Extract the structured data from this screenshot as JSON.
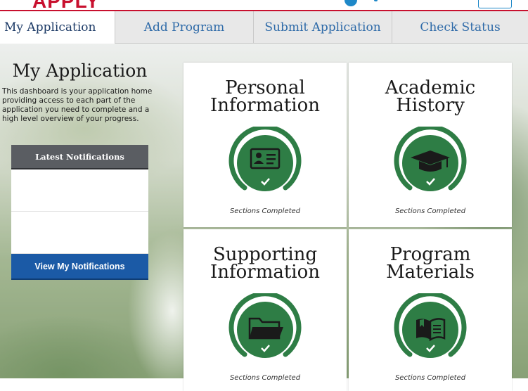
{
  "header": {
    "logo_text": "APPLY"
  },
  "tabs": [
    {
      "label": "My Application",
      "active": true
    },
    {
      "label": "Add Program",
      "active": false
    },
    {
      "label": "Submit Application",
      "active": false
    },
    {
      "label": "Check Status",
      "active": false
    }
  ],
  "dashboard": {
    "title": "My Application",
    "description": "This dashboard is your application home providing access to each part of the application you need to complete and a high level overview of your progress."
  },
  "notifications": {
    "header": "Latest Notifications",
    "button_label": "View My Notifications"
  },
  "cards": [
    {
      "title_line1": "Personal",
      "title_line2": "Information",
      "icon": "id-card-icon",
      "status_icon": "checkmark-icon",
      "status_text": "Sections Completed"
    },
    {
      "title_line1": "Academic",
      "title_line2": "History",
      "icon": "graduation-cap-icon",
      "status_icon": "checkmark-icon",
      "status_text": "Sections Completed"
    },
    {
      "title_line1": "Supporting",
      "title_line2": "Information",
      "icon": "folder-icon",
      "status_icon": "checkmark-icon",
      "status_text": "Sections Completed"
    },
    {
      "title_line1": "Program",
      "title_line2": "Materials",
      "icon": "book-icon",
      "status_icon": "checkmark-icon",
      "status_text": "Sections Completed"
    }
  ],
  "colors": {
    "accent_red": "#c8102e",
    "tab_link": "#2e6aa8",
    "progress_green": "#2e7d45",
    "button_blue": "#1b5aa6",
    "notif_header": "#5a5d62"
  }
}
